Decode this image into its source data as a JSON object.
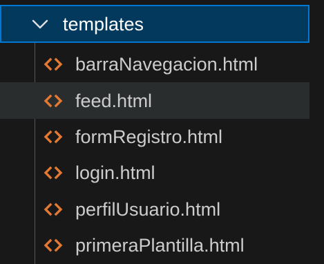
{
  "explorer": {
    "folder": {
      "name": "templates",
      "expanded": true,
      "chevron_icon": "chevron-down-icon"
    },
    "files": [
      {
        "name": "barraNavegacion.html",
        "icon": "html-file-icon"
      },
      {
        "name": "feed.html",
        "icon": "html-file-icon"
      },
      {
        "name": "formRegistro.html",
        "icon": "html-file-icon"
      },
      {
        "name": "login.html",
        "icon": "html-file-icon"
      },
      {
        "name": "perfilUsuario.html",
        "icon": "html-file-icon"
      },
      {
        "name": "primeraPlantilla.html",
        "icon": "html-file-icon"
      }
    ],
    "hovered_index": 1,
    "colors": {
      "background": "#181818",
      "folder_row_bg": "#04395e",
      "focus_border": "#0078d4",
      "hover_bg": "#2a2d2e",
      "html_icon": "#e37933",
      "text": "#cccccc"
    }
  }
}
